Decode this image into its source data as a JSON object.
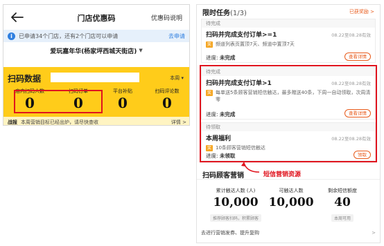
{
  "left": {
    "header": {
      "title": "门店优惠码",
      "link": "优惠码说明"
    },
    "notice": {
      "icon": "info-icon",
      "glyph": "i",
      "text": "已申请34个门店，还有2个门店可以申请",
      "action": "去申请"
    },
    "store": {
      "name": "爱玩嘉年华(杨家坪西城天街店)",
      "caret": "▼"
    },
    "scan": {
      "title": "扫码数据",
      "range": "本周 ▾",
      "metrics": [
        {
          "label": "店内扫码人数",
          "value": "0"
        },
        {
          "label": "扫码订单",
          "value": "0"
        },
        {
          "label": "平台补贴",
          "value": "0"
        },
        {
          "label": "扫码评论数",
          "value": "0"
        }
      ],
      "footer": {
        "label": "战报",
        "text": "本周营销目标已经出炉，请尽快查收",
        "link": "详情 >"
      }
    }
  },
  "right": {
    "header": {
      "title": "限时任务",
      "count": "(1/3)",
      "action": "已获奖励 >"
    },
    "tasks": [
      {
        "status": "待完成",
        "name": "扫码并完成支付订单>=1",
        "date": "08.22至08.28有效",
        "tag": "奖",
        "desc": "频道列表页置顶7天、频道中置顶7天",
        "progress_label": "进度:",
        "progress_value": "未完成",
        "button": "查看详情"
      },
      {
        "status": "待完成",
        "name": "扫码并完成支付订单>1",
        "date": "08.22至08.28有效",
        "tag": "奖",
        "desc": "每单送5条顾客营销短信触达，最多赠送40条，下周一自动领取，次周清零",
        "progress_label": "进度:",
        "progress_value": "未完成",
        "button": "查看详情"
      },
      {
        "status": "待领取",
        "name": "本周福利",
        "date": "08.22至08.28有效",
        "tag": "奖",
        "desc": "10条顾客营销短信触达",
        "progress_label": "进度:",
        "progress_value": "未领取",
        "button": "领取"
      }
    ],
    "callout": "短信营销资源",
    "marketing": {
      "title": "扫码顾客营销",
      "stats": [
        {
          "label": "累计触达人数 (人)",
          "value": "10,000",
          "sub": "推荐顾客扫码，积累顾客"
        },
        {
          "label": "可触达人数",
          "value": "10,000",
          "sub": ""
        },
        {
          "label": "剩余短信额度",
          "value": "40",
          "sub": "本周可用"
        }
      ],
      "footer": {
        "text": "去进行营销发券、提升复购",
        "chevron": ">"
      }
    }
  }
}
